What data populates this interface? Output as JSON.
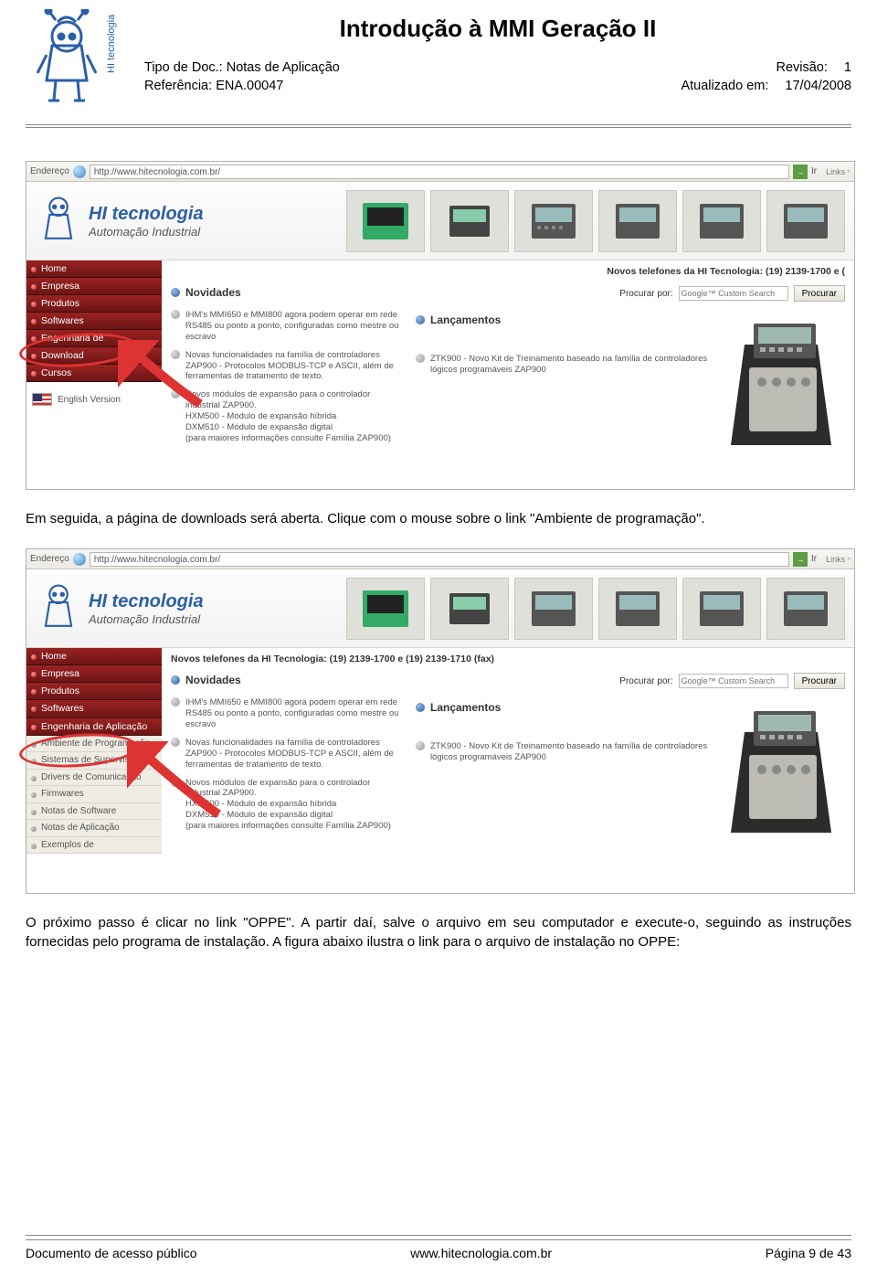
{
  "header": {
    "title": "Introdução à MMI Geração II",
    "tipo_doc_label": "Tipo de Doc.:",
    "tipo_doc_value": "Notas de Aplicação",
    "ref_label": "Referência:",
    "ref_value": "ENA.00047",
    "rev_label": "Revisão:",
    "rev_value": "1",
    "atual_label": "Atualizado em:",
    "atual_value": "17/04/2008",
    "logo_text": "HI tecnologia"
  },
  "body": {
    "para1": "Em seguida, a página de downloads será aberta. Clique com o mouse sobre o link \"Ambiente de programação\".",
    "para2": "O próximo passo é clicar no link \"OPPE\". A partir daí, salve o arquivo em seu computador e execute-o, seguindo as instruções fornecidas pelo programa de instalação. A figura abaixo ilustra o link para o arquivo de instalação no OPPE:"
  },
  "screenshot1": {
    "addr_label": "Endereço",
    "url": "http://www.hitecnologia.com.br/",
    "ir": "Ir",
    "links": "Links",
    "brand_l1": "HI tecnologia",
    "brand_l2": "Automação Industrial",
    "phones": "Novos telefones da HI Tecnologia: (19) 2139-1700 e (",
    "search_label": "Procurar por:",
    "search_placeholder": "Google™ Custom Search",
    "search_btn": "Procurar",
    "menu": [
      "Home",
      "Empresa",
      "Produtos",
      "Softwares",
      "Engenharia de",
      "Download",
      "Cursos"
    ],
    "english": "English Version",
    "section_nov": "Novidades",
    "section_lan": "Lançamentos",
    "news": [
      "IHM's MMI650 e MMI800 agora podem operar em rede RS485 ou ponto a ponto, configuradas como mestre ou escravo",
      "Novas funcionalidades na família de controladores ZAP900 - Protocolos MODBUS-TCP e ASCII, além de ferramentas de tratamento de texto.",
      "Novos módulos de expansão para o controlador industrial ZAP900.\nHXM500 - Módulo de expansão híbrida\nDXM510 - Módulo de expansão digital\n(para maiores informações consulte Família ZAP900)"
    ],
    "launch": "ZTK900 - Novo Kit de Treinamento baseado na família de controladores lógicos programáveis ZAP900"
  },
  "screenshot2": {
    "addr_label": "Endereço",
    "url": "http://www.hitecnologia.com.br/",
    "ir": "Ir",
    "links": "Links",
    "brand_l1": "HI tecnologia",
    "brand_l2": "Automação Industrial",
    "phones": "Novos telefones da HI Tecnologia: (19) 2139-1700 e (19) 2139-1710 (fax)",
    "search_label": "Procurar por:",
    "search_placeholder": "Google™ Custom Search",
    "search_btn": "Procurar",
    "menu": [
      "Home",
      "Empresa",
      "Produtos",
      "Softwares",
      "Engenharia de Aplicação"
    ],
    "submenu": [
      "Ambiente de Programação",
      "Sistemas de Supervisão",
      "Drivers de Comunicação",
      "Firmwares",
      "Notas de Software",
      "Notas de Aplicação",
      "Exemplos de"
    ],
    "section_nov": "Novidades",
    "section_lan": "Lançamentos",
    "news": [
      "IHM's MMI650 e MMI800 agora podem operar em rede RS485 ou ponto a ponto, configuradas como mestre ou escravo",
      "Novas funcionalidades na família de controladores ZAP900 - Protocolos MODBUS-TCP e ASCII, além de ferramentas de tratamento de texto.",
      "Novos módulos de expansão para o controlador industrial ZAP900.\nHXM500 - Módulo de expansão híbrida\nDXM510 - Módulo de expansão digital\n(para maiores informações consulte Família ZAP900)"
    ],
    "launch": "ZTK900 - Novo Kit de Treinamento baseado na família de controladores lógicos programáveis ZAP900"
  },
  "footer": {
    "left": "Documento de acesso público",
    "center": "www.hitecnologia.com.br",
    "right": "Página 9 de 43"
  }
}
